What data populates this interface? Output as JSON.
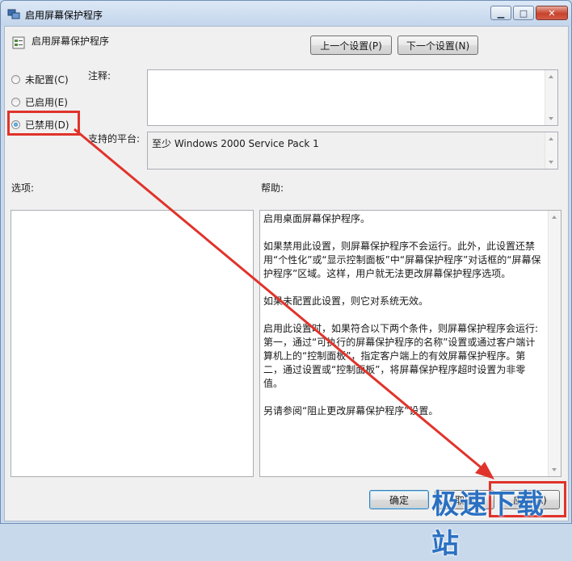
{
  "window": {
    "title": "启用屏幕保护程序",
    "controls": {
      "minimize": "▁",
      "maximize": "□",
      "close": "✕"
    }
  },
  "policy": {
    "name": "启用屏幕保护程序"
  },
  "nav": {
    "prev": "上一个设置(P)",
    "next": "下一个设置(N)"
  },
  "state": {
    "options": [
      {
        "label": "未配置(C)",
        "selected": false
      },
      {
        "label": "已启用(E)",
        "selected": false
      },
      {
        "label": "已禁用(D)",
        "selected": true
      }
    ]
  },
  "comment": {
    "label": "注释:",
    "value": ""
  },
  "platform": {
    "label": "支持的平台:",
    "value": "至少 Windows 2000 Service Pack 1"
  },
  "options_panel": {
    "label": "选项:"
  },
  "help": {
    "label": "帮助:",
    "paragraphs": [
      "启用桌面屏幕保护程序。",
      "如果禁用此设置，则屏幕保护程序不会运行。此外，此设置还禁用“个性化”或“显示控制面板”中“屏幕保护程序”对话框的“屏幕保护程序”区域。这样，用户就无法更改屏幕保护程序选项。",
      "如果未配置此设置，则它对系统无效。",
      "启用此设置时，如果符合以下两个条件，则屏幕保护程序会运行: 第一，通过“可执行的屏幕保护程序的名称”设置或通过客户端计算机上的“控制面板”，指定客户端上的有效屏幕保护程序。第二，通过设置或“控制面板”，将屏幕保护程序超时设置为非零值。",
      "另请参阅“阻止更改屏幕保护程序”设置。"
    ]
  },
  "footer": {
    "ok": "确定",
    "cancel": "取消",
    "apply": "应用(A)"
  },
  "watermark": "极速下载站",
  "colors": {
    "highlight": "#e0332b",
    "watermark": "#2a70c2"
  }
}
